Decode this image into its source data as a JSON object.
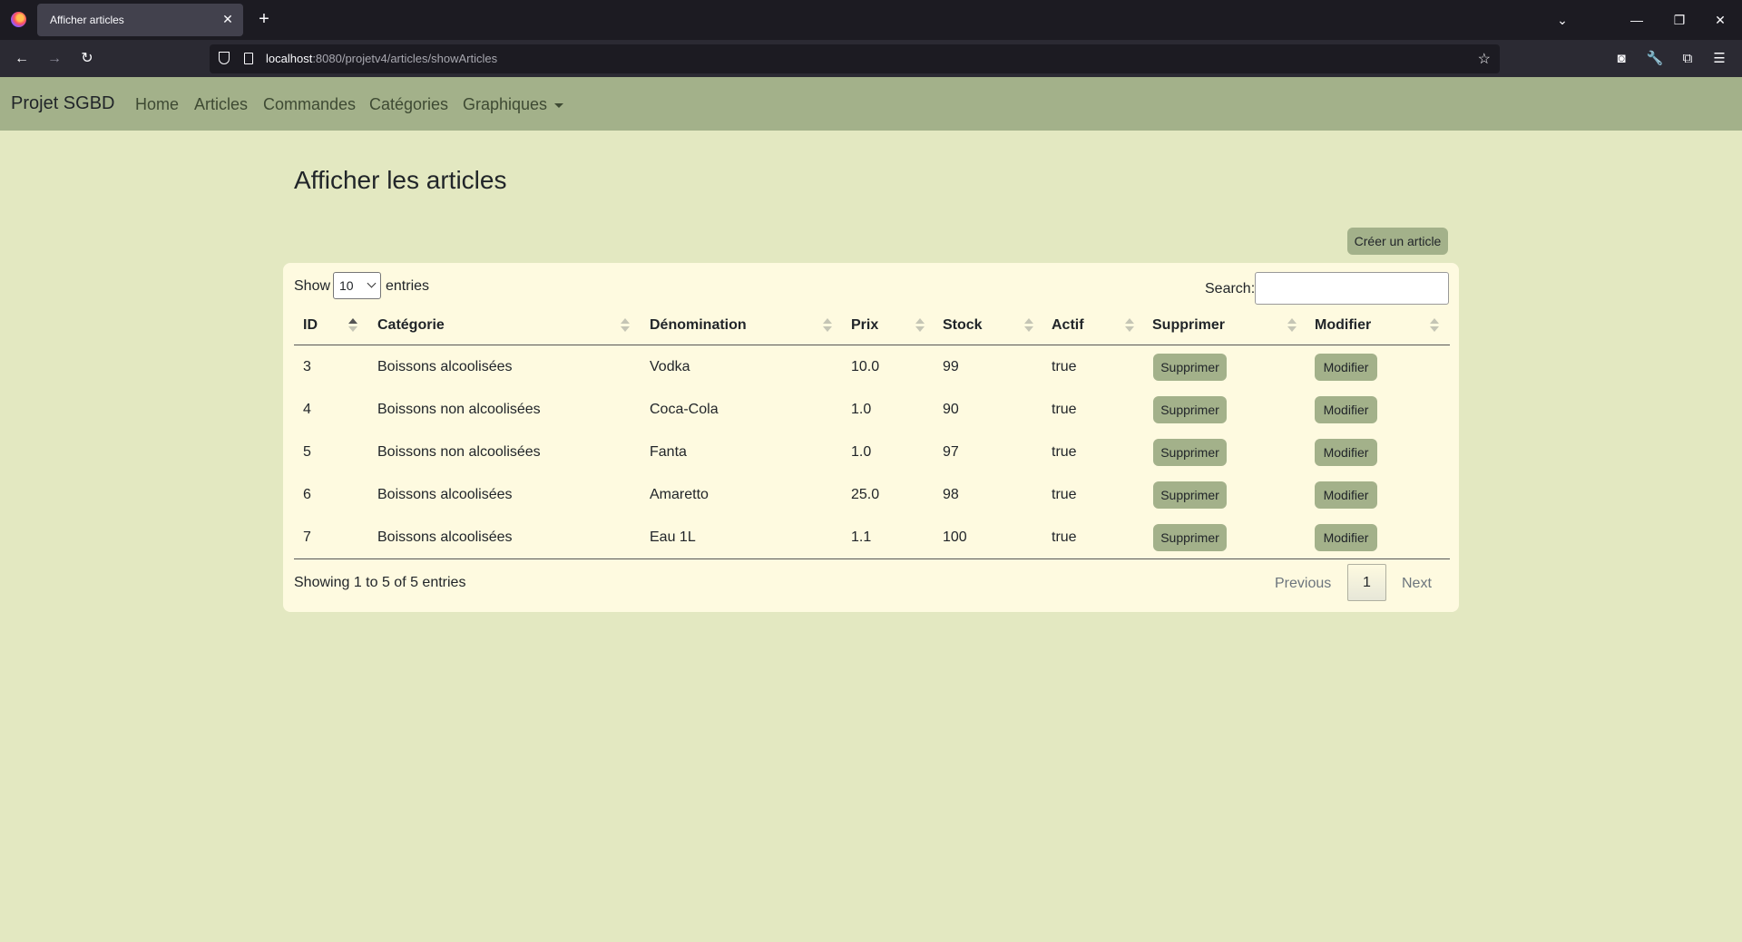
{
  "browser": {
    "tab_title": "Afficher articles",
    "url_host": "localhost",
    "url_rest": ":8080/projetv4/articles/showArticles"
  },
  "navbar": {
    "brand": "Projet SGBD",
    "links": [
      "Home",
      "Articles",
      "Commandes",
      "Catégories",
      "Graphiques"
    ]
  },
  "page": {
    "title": "Afficher les articles",
    "create_button": "Créer un article"
  },
  "table_controls": {
    "show_label": "Show",
    "length_value": "10",
    "entries_label": "entries",
    "search_label": "Search:",
    "search_value": ""
  },
  "table": {
    "columns": [
      "ID",
      "Catégorie",
      "Dénomination",
      "Prix",
      "Stock",
      "Actif",
      "Supprimer",
      "Modifier"
    ],
    "rows": [
      {
        "id": "3",
        "categorie": "Boissons alcoolisées",
        "denomination": "Vodka",
        "prix": "10.0",
        "stock": "99",
        "actif": "true",
        "delete_label": "Supprimer",
        "edit_label": "Modifier"
      },
      {
        "id": "4",
        "categorie": "Boissons non alcoolisées",
        "denomination": "Coca-Cola",
        "prix": "1.0",
        "stock": "90",
        "actif": "true",
        "delete_label": "Supprimer",
        "edit_label": "Modifier"
      },
      {
        "id": "5",
        "categorie": "Boissons non alcoolisées",
        "denomination": "Fanta",
        "prix": "1.0",
        "stock": "97",
        "actif": "true",
        "delete_label": "Supprimer",
        "edit_label": "Modifier"
      },
      {
        "id": "6",
        "categorie": "Boissons alcoolisées",
        "denomination": "Amaretto",
        "prix": "25.0",
        "stock": "98",
        "actif": "true",
        "delete_label": "Supprimer",
        "edit_label": "Modifier"
      },
      {
        "id": "7",
        "categorie": "Boissons alcoolisées",
        "denomination": "Eau 1L",
        "prix": "1.1",
        "stock": "100",
        "actif": "true",
        "delete_label": "Supprimer",
        "edit_label": "Modifier"
      }
    ]
  },
  "pagination": {
    "info": "Showing 1 to 5 of 5 entries",
    "previous": "Previous",
    "current_page": "1",
    "next": "Next"
  },
  "colors": {
    "page_bg": "#e3e8c1",
    "navbar_bg": "#a3b18a",
    "card_bg": "#fefae0",
    "button_bg": "#a3b18a"
  }
}
